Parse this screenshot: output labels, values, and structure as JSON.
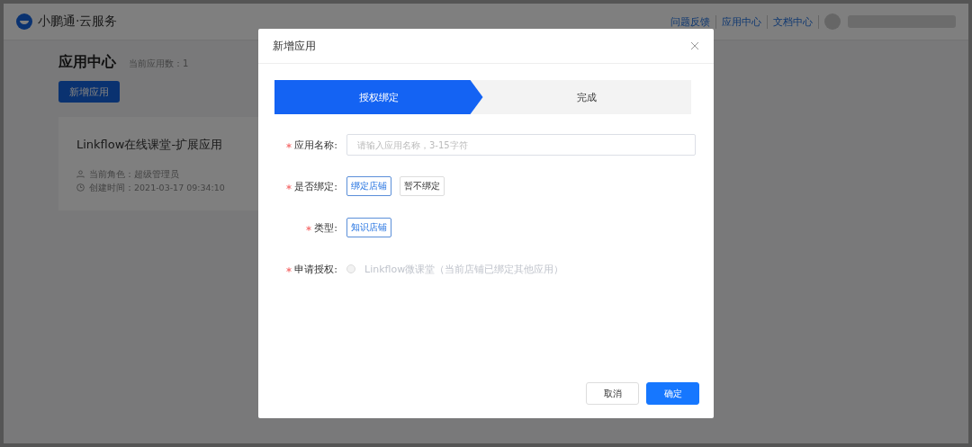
{
  "header": {
    "brand": "小鹏通·云服务",
    "links": [
      "问题反馈",
      "应用中心",
      "文档中心"
    ]
  },
  "page": {
    "title": "应用中心",
    "count": "当前应用数：1",
    "add_button": "新增应用"
  },
  "app_card": {
    "name": "Linkflow在线课堂-扩展应用",
    "role": "当前角色：超级管理员",
    "created": "创建时间：2021-03-17 09:34:10"
  },
  "dialog": {
    "title": "新增应用",
    "steps": [
      {
        "label": "授权绑定",
        "selected": true
      },
      {
        "label": "完成",
        "selected": false
      }
    ],
    "fields": [
      {
        "kind": "input",
        "label": "应用名称:",
        "required": true,
        "placeholder": "请输入应用名称，3-15字符"
      },
      {
        "kind": "choices",
        "label": "是否绑定:",
        "required": true,
        "options": [
          {
            "label": "绑定店铺",
            "selected": true
          },
          {
            "label": "暂不绑定",
            "selected": false
          }
        ]
      },
      {
        "kind": "choices",
        "label": "类型:",
        "required": true,
        "options": [
          {
            "label": "知识店铺",
            "selected": true
          }
        ]
      },
      {
        "kind": "radio",
        "label": "申请授权:",
        "required": true,
        "options": [
          {
            "label": "Linkflow微课堂（当前店铺已绑定其他应用）",
            "checked": false,
            "disabled": true
          }
        ]
      }
    ],
    "buttons": [
      {
        "label": "取消",
        "kind": "secondary"
      },
      {
        "label": "确定",
        "kind": "primary"
      }
    ]
  }
}
